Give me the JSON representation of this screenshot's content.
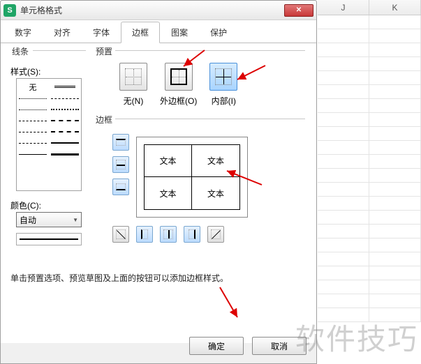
{
  "dialog": {
    "appIconLetter": "S",
    "title": "单元格格式",
    "closeGlyph": "✕"
  },
  "tabs": {
    "t0": "数字",
    "t1": "对齐",
    "t2": "字体",
    "t3": "边框",
    "t4": "图案",
    "t5": "保护"
  },
  "groups": {
    "lines": "线条",
    "preset": "预置",
    "border": "边框"
  },
  "styleLabel": "样式(S):",
  "noneText": "无",
  "colorLabel": "颜色(C):",
  "colorValue": "自动",
  "presets": {
    "none": "无(N)",
    "outer": "外边框(O)",
    "inner": "内部(I)"
  },
  "preview": {
    "c1": "文本",
    "c2": "文本",
    "c3": "文本",
    "c4": "文本"
  },
  "hint": "单击预置选项、预览草图及上面的按钮可以添加边框样式。",
  "buttons": {
    "ok": "确定",
    "cancel": "取消"
  },
  "sheet": {
    "colJ": "J",
    "colK": "K"
  },
  "watermark": "软件技巧"
}
